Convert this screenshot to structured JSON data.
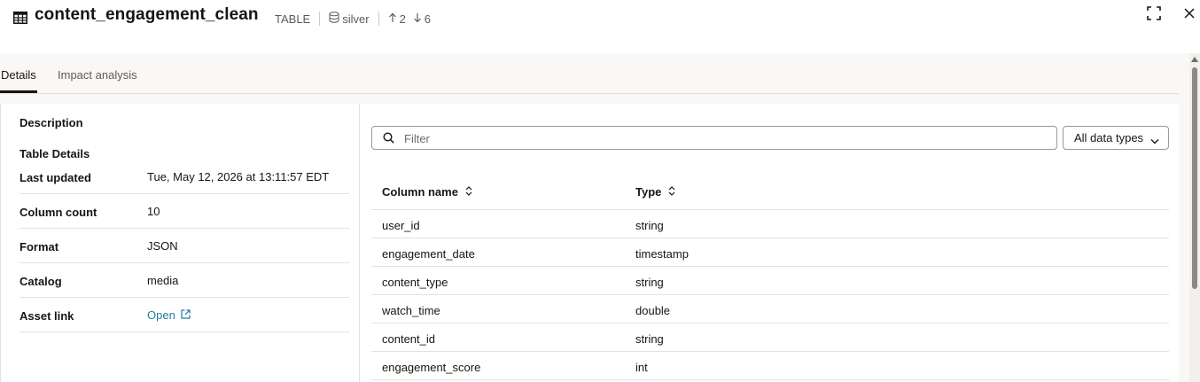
{
  "header": {
    "title": "content_engagement_clean",
    "object_type": "TABLE",
    "schema": "silver",
    "upstream_count": "2",
    "downstream_count": "6",
    "icons": {
      "title": "table-icon",
      "schema": "database-icon",
      "upstream": "arrow-up-icon",
      "downstream": "arrow-down-icon",
      "expand": "expand-icon",
      "close": "close-icon"
    }
  },
  "tabs": [
    {
      "label": "Details",
      "active": true
    },
    {
      "label": "Impact analysis",
      "active": false
    }
  ],
  "details": {
    "description_label": "Description",
    "table_details_label": "Table Details",
    "rows": [
      {
        "key": "Last updated",
        "value": "Tue, May 12, 2026 at 13:11:57 EDT"
      },
      {
        "key": "Column count",
        "value": "10"
      },
      {
        "key": "Format",
        "value": "JSON"
      },
      {
        "key": "Catalog",
        "value": "media"
      },
      {
        "key": "Asset link",
        "value": "Open",
        "is_link": true,
        "icon": "external-link-icon"
      }
    ]
  },
  "columns_panel": {
    "filter_placeholder": "Filter",
    "data_type_select": "All data types",
    "headers": {
      "name": "Column name",
      "type": "Type"
    },
    "rows": [
      {
        "name": "user_id",
        "type": "string"
      },
      {
        "name": "engagement_date",
        "type": "timestamp"
      },
      {
        "name": "content_type",
        "type": "string"
      },
      {
        "name": "watch_time",
        "type": "double"
      },
      {
        "name": "content_id",
        "type": "string"
      },
      {
        "name": "engagement_score",
        "type": "int"
      }
    ]
  },
  "colors": {
    "accent_link": "#227e9e",
    "text_primary": "#161513",
    "text_secondary": "#5e5b57",
    "panel_background": "#f9f8f7",
    "divider": "#e4e1dd"
  }
}
